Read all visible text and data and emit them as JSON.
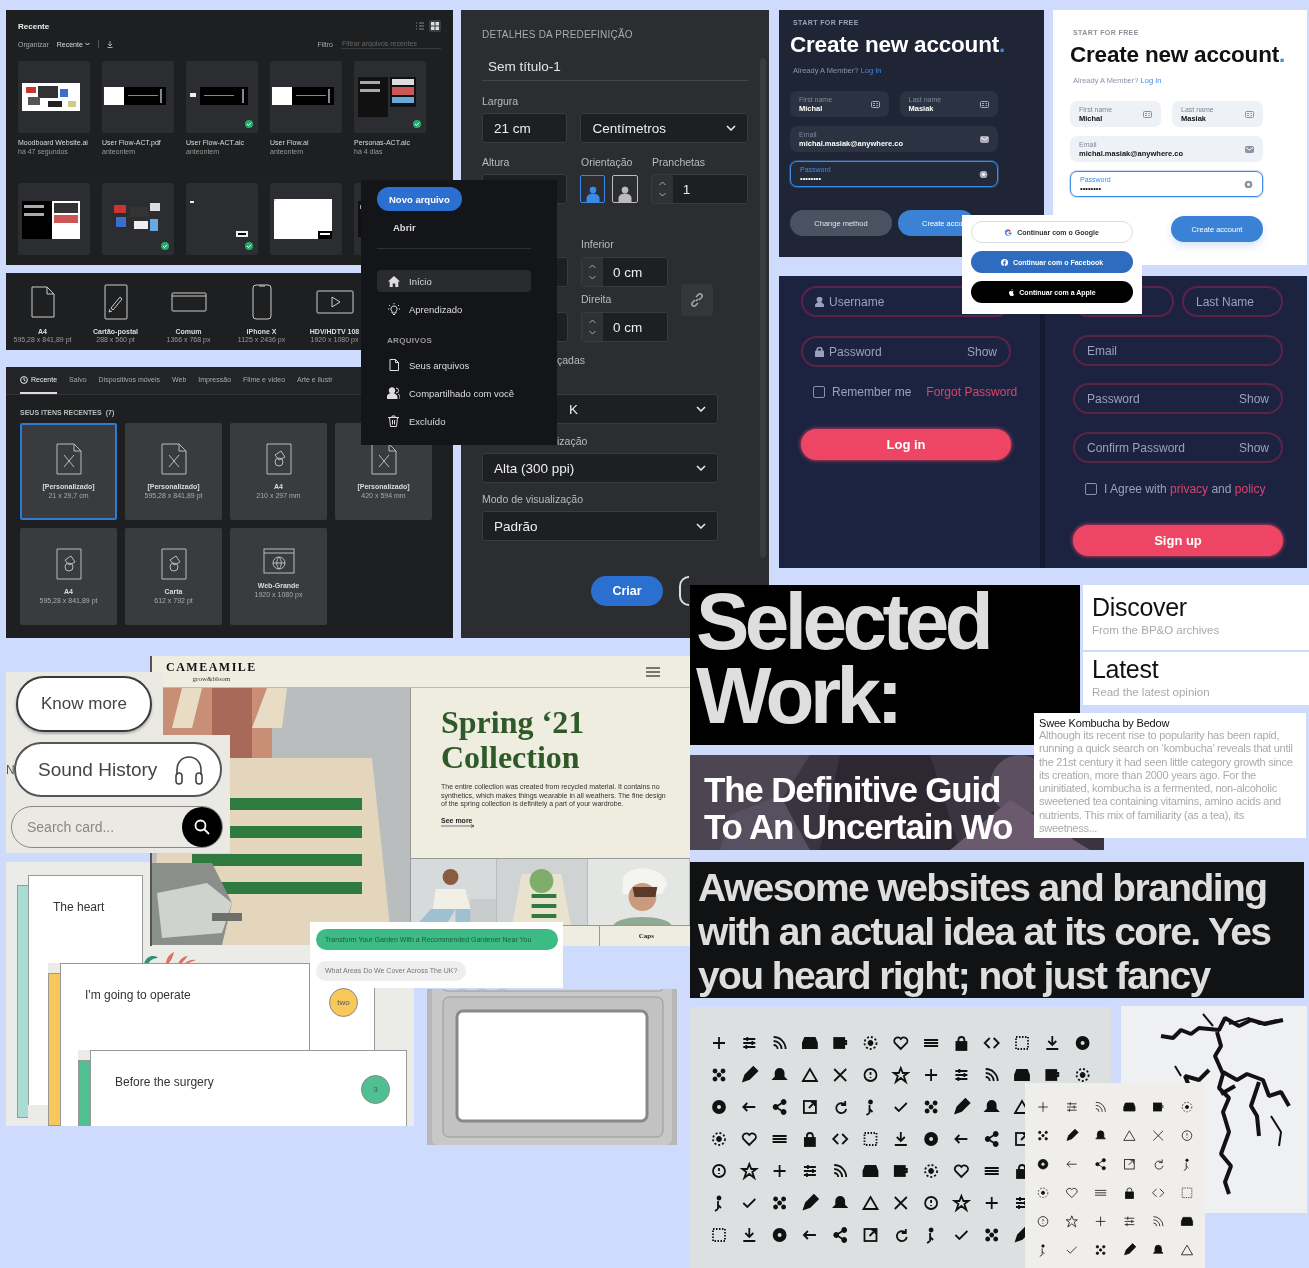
{
  "recent_files": {
    "title": "Recente",
    "organize": "Organizar",
    "sort": "Recente",
    "filter_label": "Filtro",
    "filter": {
      "placeholder": "Filtrar arquivos recentes"
    },
    "view_modes": [
      {
        "selected": false
      },
      {
        "selected": true
      }
    ],
    "files": [
      {
        "name": "Moodboard Website.ai",
        "time": "há 47 segundos",
        "synced": false
      },
      {
        "name": "User Flow-ACT.pdf",
        "time": "anteontem",
        "synced": false
      },
      {
        "name": "User Flow-ACT.aic",
        "time": "anteontem",
        "synced": true
      },
      {
        "name": "User Flow.ai",
        "time": "anteontem",
        "synced": false
      },
      {
        "name": "Personas-ACT.aic",
        "time": "há 4 dias",
        "synced": true
      }
    ],
    "thumbnails": [
      {
        "synced": false
      },
      {
        "synced": true
      },
      {
        "synced": true
      },
      {
        "synced": false
      },
      {
        "synced": false
      }
    ]
  },
  "presets": [
    {
      "name": "A4",
      "size": "595,28 x 841,89 pt",
      "kind": "page"
    },
    {
      "name": "Cartão-postal",
      "size": "288 x 560 pt",
      "kind": "postcard"
    },
    {
      "name": "Comum",
      "size": "1366 x 768 px",
      "kind": "screen"
    },
    {
      "name": "iPhone X",
      "size": "1125 x 2436 px",
      "kind": "phone"
    },
    {
      "name": "HDV/HDTV 108",
      "size": "1920 x 1080 px",
      "kind": "video"
    }
  ],
  "new_document": {
    "tabs": [
      {
        "label": "Recente",
        "selected": true
      },
      {
        "label": "Salvo",
        "selected": false
      },
      {
        "label": "Dispositivos móveis",
        "selected": false
      },
      {
        "label": "Web",
        "selected": false
      },
      {
        "label": "Impressão",
        "selected": false
      },
      {
        "label": "Filme e vídeo",
        "selected": false
      },
      {
        "label": "Arte e ilustr",
        "selected": false
      }
    ],
    "section_title": "SEUS ITENS RECENTES",
    "count": "(7)",
    "items": [
      {
        "title": "[Personalizado]",
        "size": "21 x 29,7 cm",
        "kind": "custom",
        "selected": true
      },
      {
        "title": "[Personalizado]",
        "size": "595,28 x 841,89 pt",
        "kind": "custom",
        "selected": false
      },
      {
        "title": "A4",
        "size": "210 x 297 mm",
        "kind": "print",
        "selected": false
      },
      {
        "title": "[Personalizado]",
        "size": "420 x 594 mm",
        "kind": "custom",
        "selected": false
      },
      {
        "title": "A4",
        "size": "595,28 x 841,89 pt",
        "kind": "print",
        "selected": false
      },
      {
        "title": "Carta",
        "size": "612 x 792 pt",
        "kind": "print",
        "selected": false
      },
      {
        "title": "Web-Grande",
        "size": "1920 x 1080 px",
        "kind": "web",
        "selected": false
      }
    ]
  },
  "preset_details": {
    "heading": "DETALHES DA PREDEFINIÇÃO",
    "name": "Sem título-1",
    "width_label": "Largura",
    "width": "21 cm",
    "units": "Centímetros",
    "height_label": "Altura",
    "orientation_label": "Orientação",
    "orientations": [
      {
        "selected": true
      },
      {
        "selected": false
      }
    ],
    "artboards_label": "Pranchetas",
    "artboards": "1",
    "bottom_label": "Inferior",
    "bottom": "0 cm",
    "right_label": "Direita",
    "right": "0 cm",
    "advanced_fragment": "çadas",
    "color_mode_fragment": "K",
    "raster_fragment": "ização",
    "raster": "Alta (300 ppi)",
    "preview_label": "Modo de visualização",
    "preview": "Padrão",
    "create": "Criar"
  },
  "home_menu": {
    "new_file": "Novo arquivo",
    "open": "Abrir",
    "nav": [
      {
        "label": "Início",
        "kind": "home",
        "selected": true
      },
      {
        "label": "Aprendizado",
        "kind": "learn",
        "selected": false
      }
    ],
    "section": "ARQUIVOS",
    "files_nav": [
      {
        "label": "Seus arquivos",
        "kind": "file",
        "selected": false
      },
      {
        "label": "Compartilhado com você",
        "kind": "shared",
        "selected": false
      },
      {
        "label": "Excluído",
        "kind": "trash",
        "selected": false
      }
    ]
  },
  "signup_cards": [
    {
      "kind": "dark",
      "eyebrow": "START FOR FREE",
      "title": "Create new account",
      "accent": ".",
      "member_prompt": "Already A Member?",
      "login_link": "Log In",
      "fields": [
        {
          "label": "First name",
          "value": "Michal",
          "kind": "name",
          "focused": false
        },
        {
          "label": "Last name",
          "value": "Masiak",
          "kind": "name",
          "focused": false
        },
        {
          "label": "Email",
          "value": "michal.masiak@anywhere.co",
          "kind": "email",
          "focused": false
        },
        {
          "label": "Password",
          "value": "••••••••",
          "kind": "password",
          "focused": true
        }
      ],
      "buttons": [
        {
          "label": "Change method",
          "kind": "secondary"
        },
        {
          "label": "Create acco",
          "kind": "primary"
        }
      ]
    },
    {
      "kind": "light",
      "eyebrow": "START FOR FREE",
      "title": "Create new account",
      "accent": ".",
      "member_prompt": "Already A Member?",
      "login_link": "Log In",
      "fields": [
        {
          "label": "First name",
          "value": "Michal",
          "kind": "name",
          "focused": false
        },
        {
          "label": "Last name",
          "value": "Masiak",
          "kind": "name",
          "focused": false
        },
        {
          "label": "Email",
          "value": "michal.masiak@anywhere.co",
          "kind": "email",
          "focused": false
        },
        {
          "label": "Password",
          "value": "••••••••",
          "kind": "password",
          "focused": true
        }
      ],
      "buttons": [
        {
          "label": "Create account",
          "kind": "primary"
        }
      ]
    }
  ],
  "social_login": {
    "buttons": [
      {
        "label": "Continuar com o Google",
        "kind": "google"
      },
      {
        "label": "Continuar com o Facebook",
        "kind": "facebook"
      },
      {
        "label": "Continuar com a Apple",
        "kind": "apple"
      }
    ]
  },
  "login_form": {
    "username": {
      "placeholder": "Username"
    },
    "password": {
      "placeholder": "Password",
      "action": "Show"
    },
    "remember": {
      "label": "Remember me",
      "checked": false
    },
    "forgot": "Forgot Password",
    "submit": "Log in"
  },
  "signup_form": {
    "last_name": {
      "placeholder": "Last Name"
    },
    "email": {
      "placeholder": "Email"
    },
    "password": {
      "placeholder": "Password",
      "action": "Show"
    },
    "confirm": {
      "placeholder": "Confirm Password",
      "action": "Show"
    },
    "agree": {
      "checked": false,
      "parts": [
        {
          "text": "I Agree with",
          "link": false
        },
        {
          "text": "privacy",
          "link": true
        },
        {
          "text": "and",
          "link": false
        },
        {
          "text": "policy",
          "link": true
        }
      ]
    },
    "submit": "Sign up"
  },
  "widgets": {
    "know_more": "Know more",
    "fragment": "N",
    "sound_history": "Sound History",
    "search": {
      "placeholder": "Search card..."
    }
  },
  "cameamile": {
    "brand": "CAMEAMILE",
    "tagline": "grow&bloom",
    "title": "Spring ‘21 Collection",
    "description": "The entire collection was created from recycled material. It contains no synthetics, which makes things wearable in all weathers. The fine design of the spring collection is definitely a part of your wardrobe.",
    "see_more": "See more",
    "caption": "Caps"
  },
  "step_cards": [
    {
      "text": "The heart",
      "color": "#a9ddd4"
    },
    {
      "text": "I'm going to operate",
      "badge": "two",
      "color": "#f8c95a"
    },
    {
      "text": "Before the surgery",
      "badge": "3",
      "color": "#50bf91"
    }
  ],
  "faq": [
    {
      "label": "Transform Your Garden With a Recommended Gardener Near You",
      "selected": true
    },
    {
      "label": "What Areas Do We Cover Across The UK?",
      "selected": false
    }
  ],
  "selected_work": {
    "lines": [
      "Selected",
      "Work:"
    ]
  },
  "guide": {
    "lines": [
      "The Definitive Guid",
      "To An Uncertain Wo"
    ]
  },
  "nav_cards": [
    {
      "title": "Discover",
      "subtitle": "From the BP&O archives"
    },
    {
      "title": "Latest",
      "subtitle": "Read the latest opinion"
    }
  ],
  "article": {
    "title": "Swee Kombucha by Bedow",
    "body": "Although its recent rise to popularity has been rapid, running a quick search on ‘kombucha’ reveals that until the 21st century it had seen little category growth since its creation, more than 2000 years ago. For the uninitiated, kombucha is a fermented, non-alcoholic sweetened tea containing vitamins, amino acids and nutrients. This mix of familiarity (as a tea), its sweetness..."
  },
  "tagline": {
    "text": "Awesome websites and branding with an actual idea at its core. Yes you heard right; not just fancy"
  }
}
